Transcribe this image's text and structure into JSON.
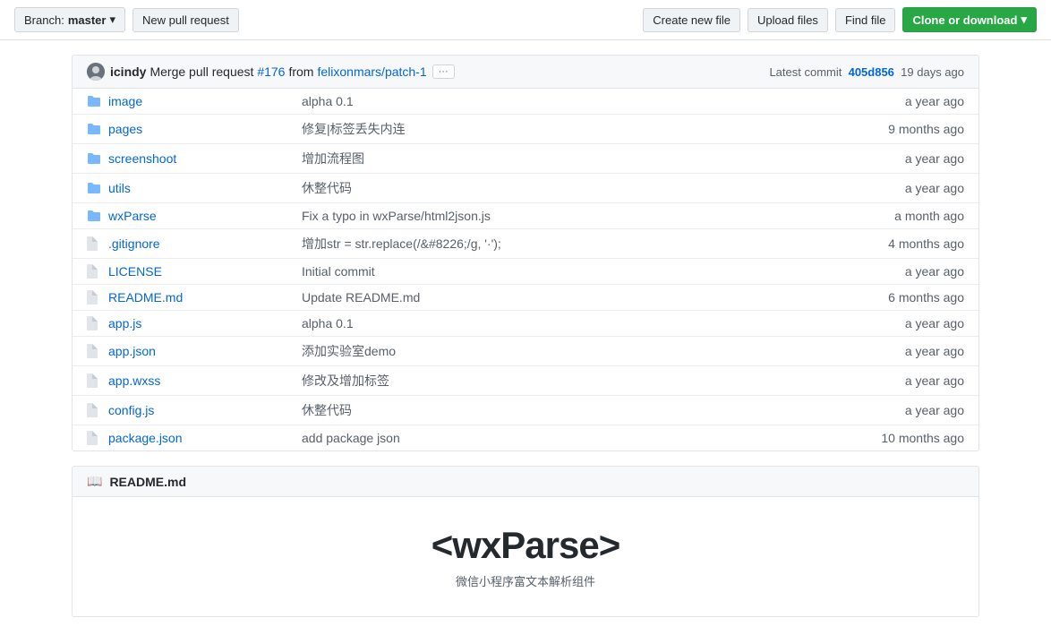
{
  "toolbar": {
    "branch_label": "Branch:",
    "branch_name": "master",
    "new_pr_label": "New pull request",
    "create_file_label": "Create new file",
    "upload_label": "Upload files",
    "find_label": "Find file",
    "clone_label": "Clone or download"
  },
  "commit_bar": {
    "author": "icindy",
    "message": "Merge pull request",
    "pr_number": "#176",
    "from_text": "from",
    "branch": "felixonmars/patch-1",
    "dots": "···",
    "latest_label": "Latest commit",
    "commit_hash": "405d856",
    "age": "19 days ago"
  },
  "files": [
    {
      "type": "folder",
      "name": "image",
      "message": "alpha 0.1",
      "age": "a year ago"
    },
    {
      "type": "folder",
      "name": "pages",
      "message": "修复|标签丢失内连",
      "age": "9 months ago"
    },
    {
      "type": "folder",
      "name": "screenshoot",
      "message": "增加流程图",
      "age": "a year ago"
    },
    {
      "type": "folder",
      "name": "utils",
      "message": "休整代码",
      "age": "a year ago"
    },
    {
      "type": "folder",
      "name": "wxParse",
      "message": "Fix a typo in wxParse/html2json.js",
      "age": "a month ago"
    },
    {
      "type": "file",
      "name": ".gitignore",
      "message": "增加str = str.replace(/&#8226;/g, '·');",
      "age": "4 months ago"
    },
    {
      "type": "file",
      "name": "LICENSE",
      "message": "Initial commit",
      "age": "a year ago"
    },
    {
      "type": "file",
      "name": "README.md",
      "message": "Update README.md",
      "age": "6 months ago"
    },
    {
      "type": "file",
      "name": "app.js",
      "message": "alpha 0.1",
      "age": "a year ago"
    },
    {
      "type": "file",
      "name": "app.json",
      "message": "添加实验室demo",
      "age": "a year ago"
    },
    {
      "type": "file",
      "name": "app.wxss",
      "message": "修改及增加标签",
      "age": "a year ago"
    },
    {
      "type": "file",
      "name": "config.js",
      "message": "休整代码",
      "age": "a year ago"
    },
    {
      "type": "file",
      "name": "package.json",
      "message": "add package json",
      "age": "10 months ago"
    }
  ],
  "readme": {
    "header": "README.md",
    "title_left": "<wxParse",
    "title_right": ">",
    "subtitle": "微信小程序富文本解析组件"
  },
  "colors": {
    "folder": "#79b8ff",
    "link": "#0366d6",
    "clone_bg": "#28a745",
    "muted": "#586069"
  }
}
